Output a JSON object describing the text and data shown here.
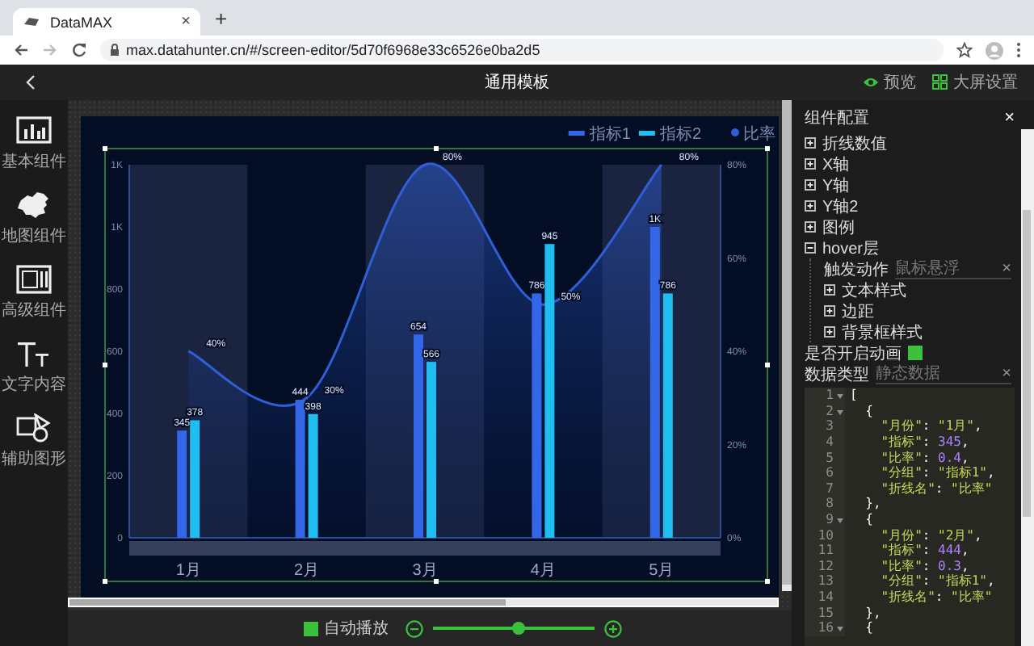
{
  "browser": {
    "tab": {
      "title": "DataMAX",
      "close": "×"
    },
    "new_tab": "+",
    "nav_buttons": [
      {
        "kind": "back",
        "disabled": false
      },
      {
        "kind": "forward",
        "disabled": true
      },
      {
        "kind": "reload",
        "disabled": false
      }
    ],
    "url": "max.datahunter.cn/#/screen-editor/5d70f6968e33c6526e0ba2d5"
  },
  "header": {
    "title": "通用模板",
    "actions": [
      {
        "kind": "preview",
        "label": "预览"
      },
      {
        "kind": "screen_settings",
        "label": "大屏设置"
      }
    ]
  },
  "sidebar": {
    "items": [
      {
        "kind": "basic",
        "label": "基本组件"
      },
      {
        "kind": "map",
        "label": "地图组件"
      },
      {
        "kind": "advanced",
        "label": "高级组件"
      },
      {
        "kind": "text",
        "label": "文字内容"
      },
      {
        "kind": "shape",
        "label": "辅助图形"
      }
    ]
  },
  "chart": {
    "bar_layer": {
      "chart_data": {
        "type": "bar",
        "categories": [
          "1月",
          "2月",
          "3月",
          "4月",
          "5月"
        ],
        "series": [
          {
            "name": "指标1",
            "color": "#3466e8",
            "values": [
              345,
              444,
              654,
              786,
              1000
            ]
          },
          {
            "name": "指标2",
            "color": "#1fbdf0",
            "values": [
              378,
              398,
              566,
              945,
              786
            ]
          }
        ],
        "ylim": [
          0,
          1200
        ],
        "yticks": [
          0,
          200,
          400,
          600,
          800,
          {
            "value": 1000,
            "label": "1K"
          },
          {
            "value": 1200,
            "label": "1K"
          }
        ],
        "value_labels": [
          [
            "345",
            "444",
            "654",
            "786",
            "1K"
          ],
          [
            "378",
            "398",
            "566",
            "945",
            "786"
          ]
        ],
        "legend": "upper right"
      }
    },
    "area_layer": {
      "chart_data": {
        "type": "area",
        "series": [
          {
            "name": "比率",
            "color": "#2f5fd6",
            "values": [
              0.4,
              0.3,
              0.8,
              0.5,
              0.8
            ]
          }
        ],
        "ylim": [
          0,
          0.8
        ],
        "yticks": [
          {
            "value": 0,
            "label": "0%"
          },
          {
            "value": 0.2,
            "label": "20%"
          },
          {
            "value": 0.4,
            "label": "40%"
          },
          {
            "value": 0.6,
            "label": "60%"
          },
          {
            "value": 0.8,
            "label": "80%"
          }
        ],
        "value_labels": [
          [
            "40%",
            "30%",
            "80%",
            "50%",
            "80%"
          ]
        ],
        "legend": "upper right"
      }
    }
  },
  "config": {
    "title": "组件配置",
    "close": "×",
    "tree": [
      {
        "label": "折线数值",
        "expanded": false
      },
      {
        "label": "X轴",
        "expanded": false
      },
      {
        "label": "Y轴",
        "expanded": false
      },
      {
        "label": "Y轴2",
        "expanded": false
      },
      {
        "label": "图例",
        "expanded": false
      },
      {
        "label": "hover层",
        "expanded": true,
        "field": {
          "label": "触发动作",
          "value": "鼠标悬浮",
          "clear": "×"
        },
        "children": [
          {
            "label": "文本样式",
            "expanded": false
          },
          {
            "label": "边距",
            "expanded": false
          },
          {
            "label": "背景框样式",
            "expanded": false
          }
        ]
      }
    ],
    "animation": {
      "label": "是否开启动画",
      "checked": true
    },
    "data_type": {
      "label": "数据类型",
      "value": "静态数据",
      "clear": "×"
    },
    "code": [
      {
        "number": "1",
        "fold": true,
        "tokens": [
          {
            "kind": "punct",
            "text": "["
          }
        ]
      },
      {
        "number": "2",
        "fold": true,
        "tokens": [
          {
            "kind": "punct",
            "text": "  {"
          }
        ]
      },
      {
        "number": "3",
        "fold": false,
        "tokens": [
          {
            "kind": "key",
            "text": "    \"月份\""
          },
          {
            "kind": "punct",
            "text": ": "
          },
          {
            "kind": "string",
            "text": "\"1月\""
          },
          {
            "kind": "punct",
            "text": ","
          }
        ]
      },
      {
        "number": "4",
        "fold": false,
        "tokens": [
          {
            "kind": "key",
            "text": "    \"指标\""
          },
          {
            "kind": "punct",
            "text": ": "
          },
          {
            "kind": "number",
            "text": "345"
          },
          {
            "kind": "punct",
            "text": ","
          }
        ]
      },
      {
        "number": "5",
        "fold": false,
        "tokens": [
          {
            "kind": "key",
            "text": "    \"比率\""
          },
          {
            "kind": "punct",
            "text": ": "
          },
          {
            "kind": "number",
            "text": "0.4"
          },
          {
            "kind": "punct",
            "text": ","
          }
        ]
      },
      {
        "number": "6",
        "fold": false,
        "tokens": [
          {
            "kind": "key",
            "text": "    \"分组\""
          },
          {
            "kind": "punct",
            "text": ": "
          },
          {
            "kind": "string",
            "text": "\"指标1\""
          },
          {
            "kind": "punct",
            "text": ","
          }
        ]
      },
      {
        "number": "7",
        "fold": false,
        "tokens": [
          {
            "kind": "key",
            "text": "    \"折线名\""
          },
          {
            "kind": "punct",
            "text": ": "
          },
          {
            "kind": "string",
            "text": "\"比率\""
          }
        ]
      },
      {
        "number": "8",
        "fold": false,
        "tokens": [
          {
            "kind": "punct",
            "text": "  },"
          }
        ]
      },
      {
        "number": "9",
        "fold": true,
        "tokens": [
          {
            "kind": "punct",
            "text": "  {"
          }
        ]
      },
      {
        "number": "10",
        "fold": false,
        "tokens": [
          {
            "kind": "key",
            "text": "    \"月份\""
          },
          {
            "kind": "punct",
            "text": ": "
          },
          {
            "kind": "string",
            "text": "\"2月\""
          },
          {
            "kind": "punct",
            "text": ","
          }
        ]
      },
      {
        "number": "11",
        "fold": false,
        "tokens": [
          {
            "kind": "key",
            "text": "    \"指标\""
          },
          {
            "kind": "punct",
            "text": ": "
          },
          {
            "kind": "number",
            "text": "444"
          },
          {
            "kind": "punct",
            "text": ","
          }
        ]
      },
      {
        "number": "12",
        "fold": false,
        "tokens": [
          {
            "kind": "key",
            "text": "    \"比率\""
          },
          {
            "kind": "punct",
            "text": ": "
          },
          {
            "kind": "number",
            "text": "0.3"
          },
          {
            "kind": "punct",
            "text": ","
          }
        ]
      },
      {
        "number": "13",
        "fold": false,
        "tokens": [
          {
            "kind": "key",
            "text": "    \"分组\""
          },
          {
            "kind": "punct",
            "text": ": "
          },
          {
            "kind": "string",
            "text": "\"指标1\""
          },
          {
            "kind": "punct",
            "text": ","
          }
        ]
      },
      {
        "number": "14",
        "fold": false,
        "tokens": [
          {
            "kind": "key",
            "text": "    \"折线名\""
          },
          {
            "kind": "punct",
            "text": ": "
          },
          {
            "kind": "string",
            "text": "\"比率\""
          }
        ]
      },
      {
        "number": "15",
        "fold": false,
        "tokens": [
          {
            "kind": "punct",
            "text": "  },"
          }
        ]
      },
      {
        "number": "16",
        "fold": true,
        "tokens": [
          {
            "kind": "punct",
            "text": "  {"
          }
        ]
      }
    ]
  },
  "bottom_bar": {
    "autoplay": {
      "label": "自动播放",
      "checked": true
    },
    "zoom": {
      "level": 0.53
    }
  }
}
